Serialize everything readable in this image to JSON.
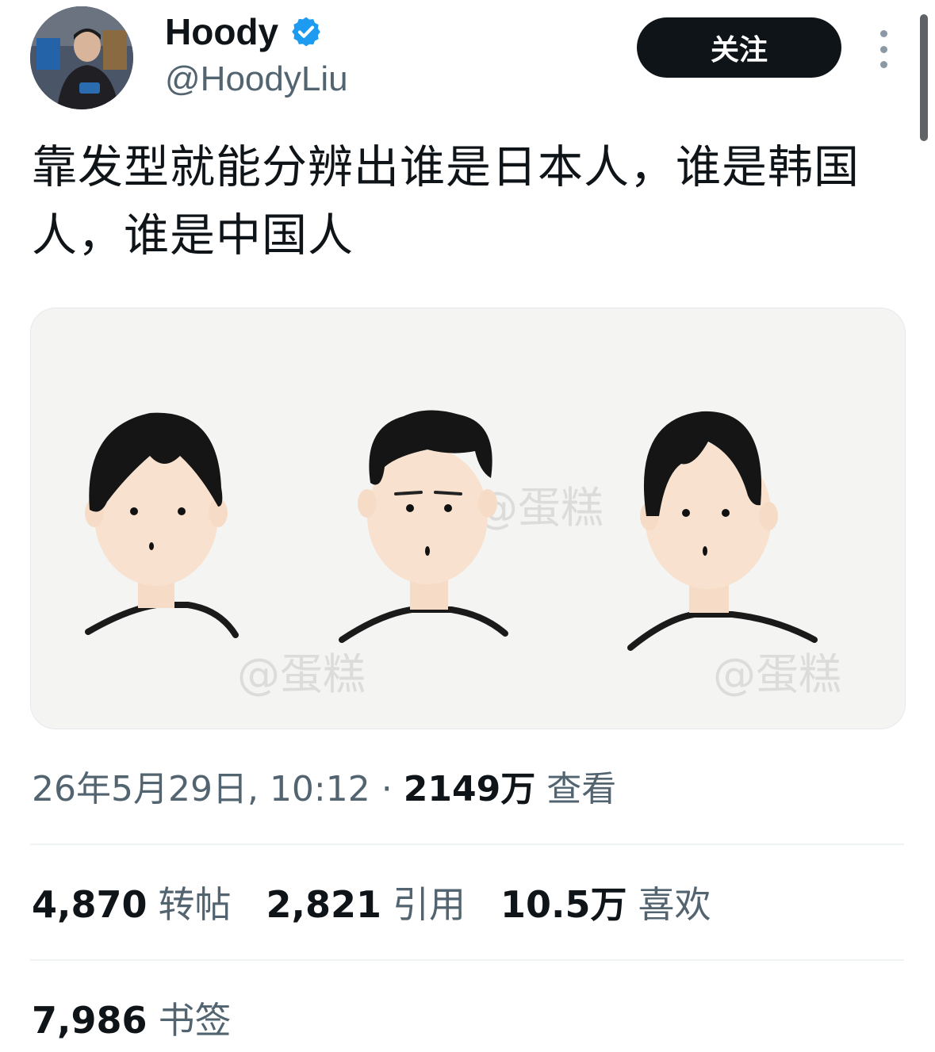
{
  "user": {
    "display_name": "Hoody",
    "handle": "@HoodyLiu",
    "verified_icon": "verified-badge-icon",
    "verified_color": "#1d9bf0"
  },
  "actions": {
    "follow_label": "关注",
    "more_icon": "more-vertical-icon"
  },
  "tweet": {
    "text": "靠发型就能分辨出谁是日本人，谁是韩国人，谁是中国人"
  },
  "media": {
    "watermark": "@蛋糕"
  },
  "meta": {
    "datetime": "26年5月29日, 10:12",
    "separator": "·",
    "views_count": "2149万",
    "views_label": "查看"
  },
  "stats": {
    "retweets": {
      "count": "4,870",
      "label": "转帖"
    },
    "quotes": {
      "count": "2,821",
      "label": "引用"
    },
    "likes": {
      "count": "10.5万",
      "label": "喜欢"
    },
    "bookmarks": {
      "count": "7,986",
      "label": "书签"
    }
  },
  "colors": {
    "text_primary": "#0f1419",
    "text_secondary": "#536471",
    "button_bg": "#0f1419",
    "divider": "#eff3f4"
  }
}
